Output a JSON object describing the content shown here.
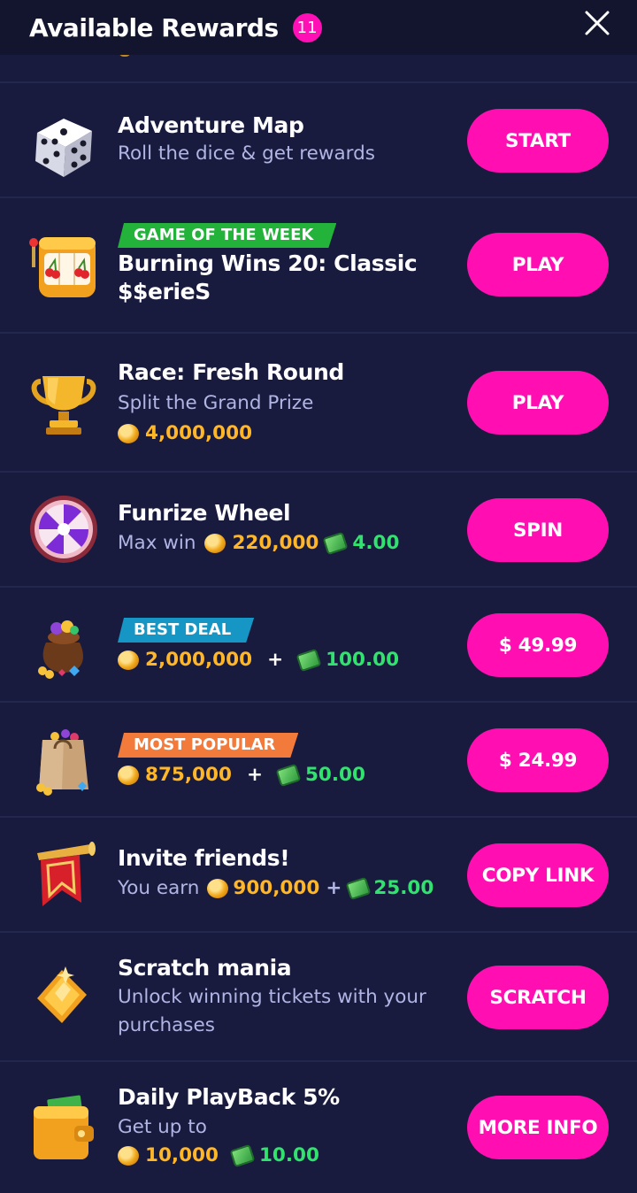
{
  "header": {
    "title": "Available Rewards",
    "count": "11"
  },
  "rows": [
    {
      "title": "Adventure Map",
      "subtitle": "Roll the dice & get rewards",
      "button": "START"
    },
    {
      "tag": "GAME OF THE WEEK",
      "title_line1": "Burning Wins 20: Classic",
      "title_line2": "$$erieS",
      "button": "PLAY"
    },
    {
      "title": "Race: Fresh Round",
      "subtitle": "Split the Grand Prize",
      "coins": "4,000,000",
      "button": "PLAY"
    },
    {
      "title": "Funrize Wheel",
      "prefix": "Max win",
      "coins": "220,000",
      "cash": "4.00",
      "button": "SPIN"
    },
    {
      "tag": "BEST DEAL",
      "coins": "2,000,000",
      "plus": "+",
      "cash": "100.00",
      "button": "$ 49.99"
    },
    {
      "tag": "MOST POPULAR",
      "coins": "875,000",
      "plus": "+",
      "cash": "50.00",
      "button": "$ 24.99"
    },
    {
      "title": "Invite friends!",
      "prefix": "You earn",
      "coins": "900,000",
      "plus": "+",
      "cash": "25.00",
      "button": "COPY LINK"
    },
    {
      "title": "Scratch mania",
      "subtitle_line1": "Unlock winning tickets with your",
      "subtitle_line2": "purchases",
      "button": "SCRATCH"
    },
    {
      "title": "Daily PlayBack 5%",
      "subtitle": "Get up to",
      "coins": "10,000",
      "cash": "10.00",
      "button": "MORE INFO"
    }
  ],
  "icons": [
    "dice-icon",
    "slot-machine-icon",
    "trophy-icon",
    "wheel-icon",
    "coin-bag-icon",
    "shopping-bag-icon",
    "banner-horn-icon",
    "scratch-ticket-icon",
    "wallet-icon"
  ],
  "colors": {
    "background": "#181a3e",
    "header": "#13152f",
    "accent": "#ff0fb2",
    "gold": "#ffb627",
    "green": "#32e26f",
    "subtitle": "#b1b5e4"
  }
}
